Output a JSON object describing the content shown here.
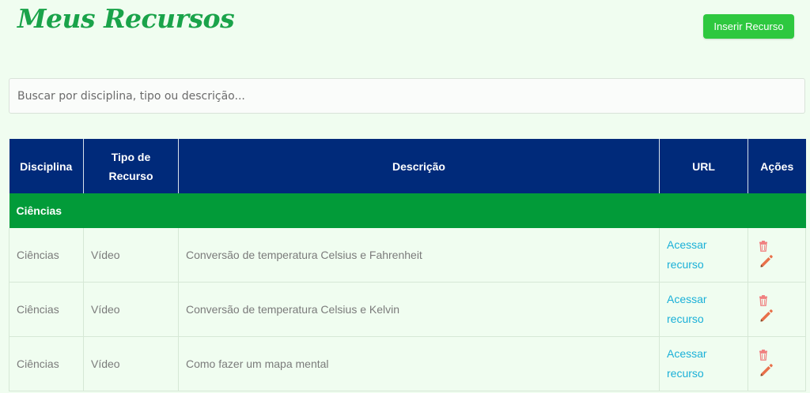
{
  "header": {
    "title": "Meus Recursos",
    "insert_button_label": "Inserir Recurso"
  },
  "search": {
    "placeholder": "Buscar por disciplina, tipo ou descrição...",
    "value": ""
  },
  "table": {
    "columns": [
      "Disciplina",
      "Tipo de Recurso",
      "Descrição",
      "URL",
      "Ações"
    ],
    "groups": [
      {
        "label": "Ciências",
        "rows": [
          {
            "disciplina": "Ciências",
            "tipo": "Vídeo",
            "descricao": "Conversão de temperatura Celsius e Fahrenheit",
            "url_label": "Acessar recurso"
          },
          {
            "disciplina": "Ciências",
            "tipo": "Vídeo",
            "descricao": "Conversão de temperatura Celsius e Kelvin",
            "url_label": "Acessar recurso"
          },
          {
            "disciplina": "Ciências",
            "tipo": "Vídeo",
            "descricao": "Como fazer um mapa mental",
            "url_label": "Acessar recurso"
          }
        ]
      }
    ]
  },
  "icons": {
    "delete": "trash-icon",
    "edit": "pencil-icon"
  },
  "colors": {
    "title": "#1aa34a",
    "primary_button": "#2ec83f",
    "table_header": "#002a7a",
    "group_row": "#029b39",
    "link": "#1ab0d8",
    "trash": "#f08080",
    "pencil": "#e8704a"
  }
}
